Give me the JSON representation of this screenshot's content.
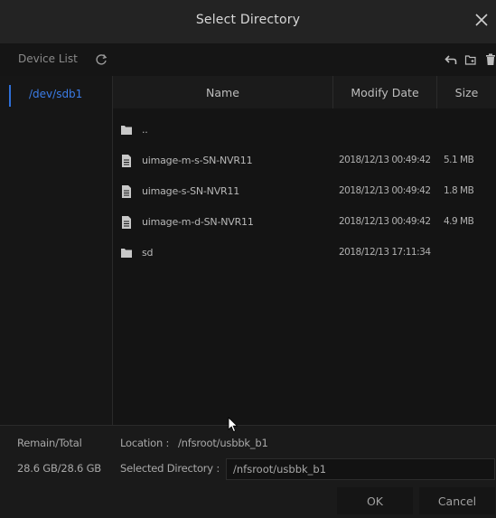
{
  "dialog": {
    "title": "Select Directory",
    "close_glyph": "✕"
  },
  "toolbar": {
    "device_list_label": "Device List",
    "icons": [
      "refresh-icon",
      "back-icon",
      "new-folder-icon",
      "delete-icon"
    ]
  },
  "devices": [
    {
      "label": "/dev/sdb1",
      "selected": true
    }
  ],
  "table": {
    "columns": [
      "Name",
      "Modify Date",
      "Size"
    ],
    "rows": [
      {
        "type": "folder",
        "name": "..",
        "date": "",
        "size": ""
      },
      {
        "type": "file",
        "name": "uimage-m-s-SN-NVR11",
        "date": "2018/12/13 00:49:42",
        "size": "5.1 MB"
      },
      {
        "type": "file",
        "name": "uimage-s-SN-NVR11",
        "date": "2018/12/13 00:49:42",
        "size": "1.8 MB"
      },
      {
        "type": "file",
        "name": "uimage-m-d-SN-NVR11",
        "date": "2018/12/13 00:49:42",
        "size": "4.9 MB"
      },
      {
        "type": "folder",
        "name": "sd",
        "date": "2018/12/13 17:11:34",
        "size": ""
      }
    ]
  },
  "footer": {
    "remain_label": "Remain/Total",
    "remain_value": "28.6 GB/28.6 GB",
    "location_label": "Location :",
    "location_value": "/nfsroot/usbbk_b1",
    "selected_label": "Selected Directory :",
    "selected_value": "/nfsroot/usbbk_b1",
    "ok_label": "OK",
    "cancel_label": "Cancel"
  },
  "colors": {
    "accent": "#3b7ce6",
    "background": "#1c1c1c"
  }
}
